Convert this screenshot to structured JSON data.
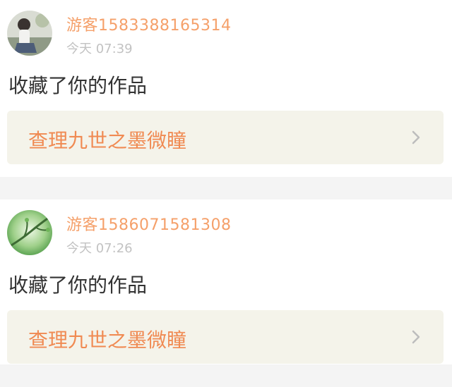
{
  "notifications": [
    {
      "username": "游客1583388165314",
      "time": "今天 07:39",
      "action": "收藏了你的作品",
      "work_title": "查理九世之墨微瞳"
    },
    {
      "username": "游客1586071581308",
      "time": "今天 07:26",
      "action": "收藏了你的作品",
      "work_title": "查理九世之墨微瞳"
    }
  ],
  "icons": {
    "chevron": "chevron-right-icon"
  }
}
